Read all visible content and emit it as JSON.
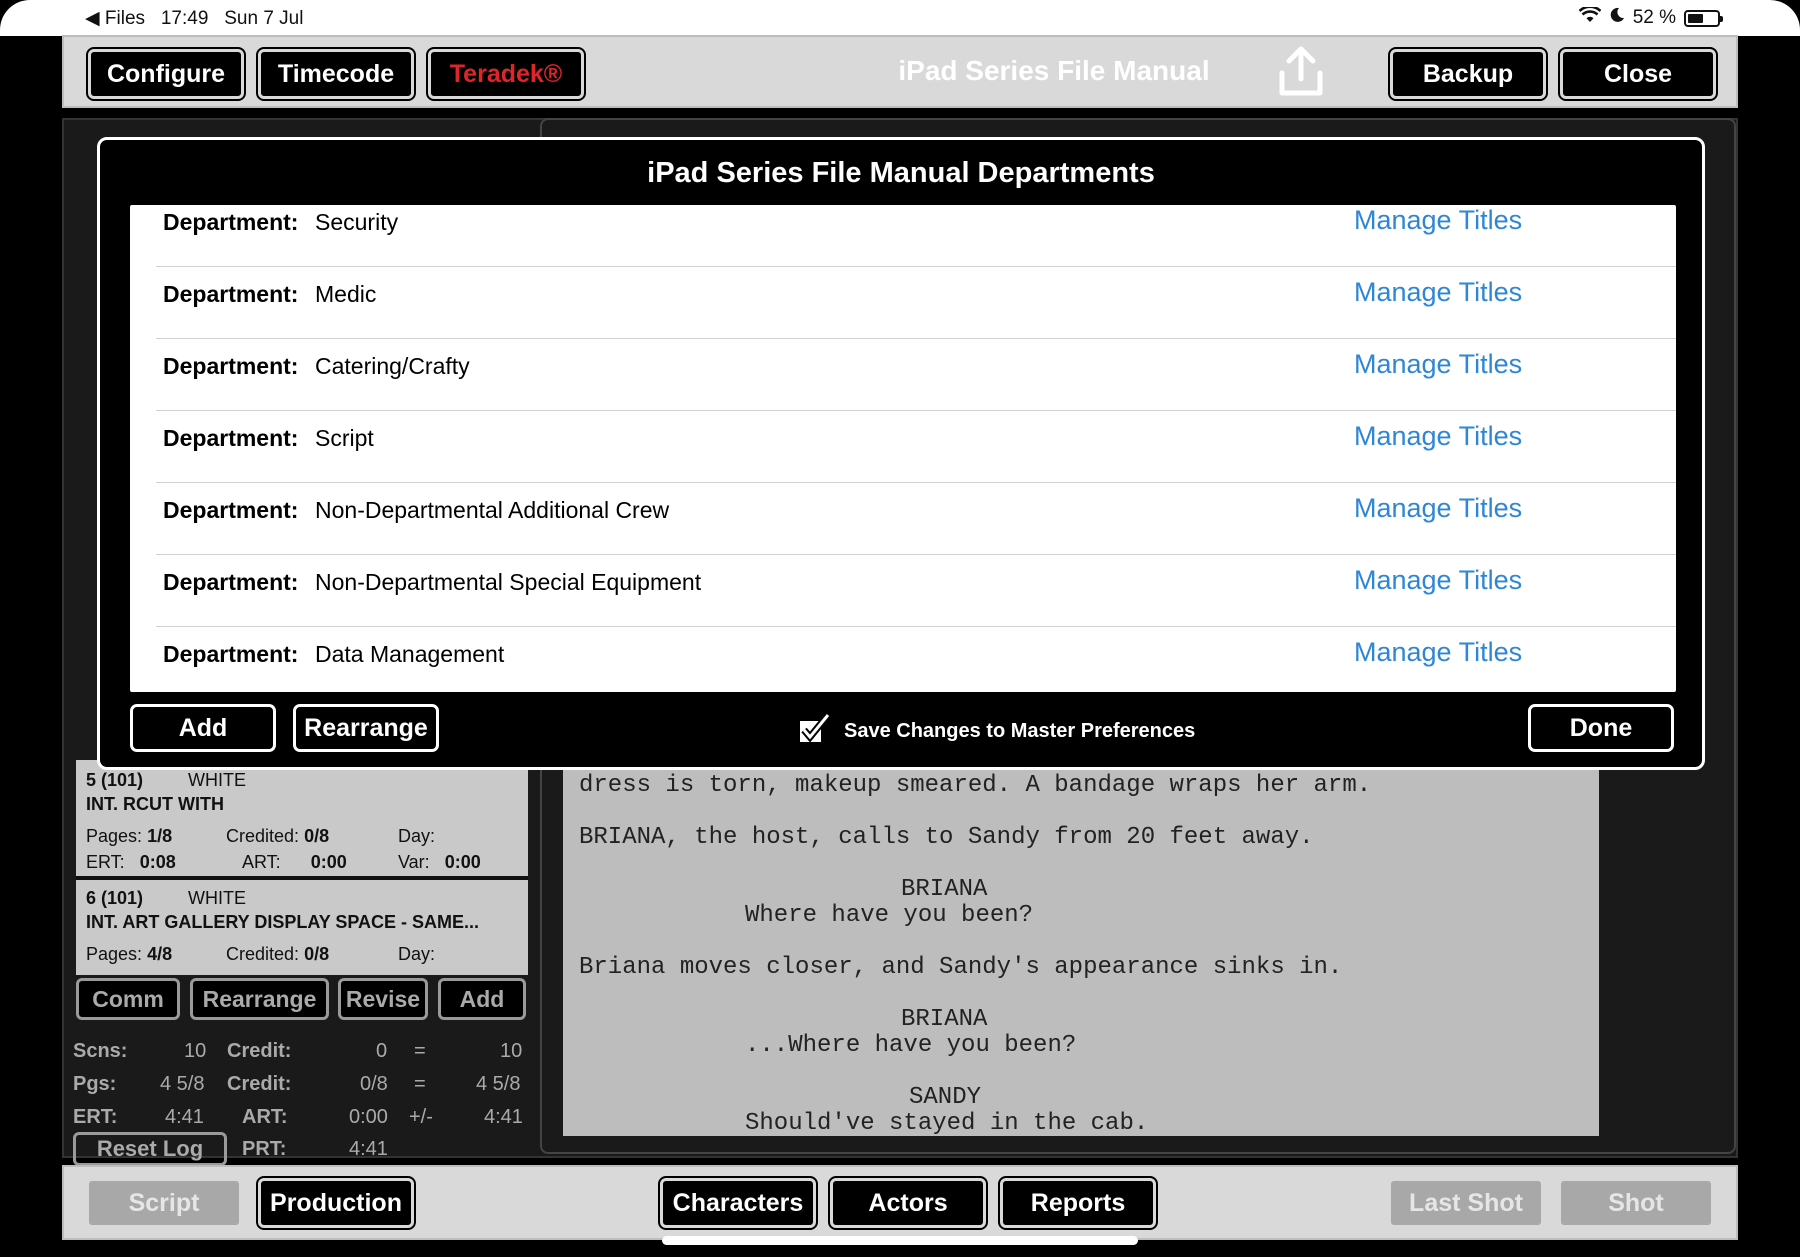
{
  "status": {
    "back_app": "Files",
    "time": "17:49",
    "date": "Sun 7 Jul",
    "battery": "52 %"
  },
  "toolbar": {
    "configure": "Configure",
    "timecode": "Timecode",
    "teradek": "Teradek®",
    "title": "iPad Series File Manual",
    "backup": "Backup",
    "close": "Close"
  },
  "modal": {
    "title": "iPad Series File Manual Departments",
    "dept_label": "Department:",
    "manage_label": "Manage Titles",
    "departments": [
      "Security",
      "Medic",
      "Catering/Crafty",
      "Script",
      "Non-Departmental Additional Crew",
      "Non-Departmental Special Equipment",
      "Data Management"
    ],
    "add": "Add",
    "rearrange": "Rearrange",
    "save_pref": "Save Changes to Master Preferences",
    "done": "Done"
  },
  "scenes": [
    {
      "num": "5 (101)",
      "color": "WHITE",
      "slug": "INT. RCUT WITH",
      "pages": "1/8",
      "credited": "0/8",
      "ert": "0:08",
      "art": "0:00",
      "var": "0:00"
    },
    {
      "num": "6 (101)",
      "color": "WHITE",
      "slug": "INT. ART GALLERY DISPLAY SPACE - SAME...",
      "pages": "4/8",
      "credited": "0/8"
    }
  ],
  "scene_labels": {
    "pages": "Pages:",
    "credited": "Credited:",
    "day": "Day:",
    "ert": "ERT:",
    "art": "ART:",
    "var": "Var:"
  },
  "list_buttons": {
    "comm": "Comm",
    "rearrange": "Rearrange",
    "revise": "Revise",
    "add": "Add"
  },
  "stats": {
    "scns_l": "Scns:",
    "scns": "10",
    "credit_l": "Credit:",
    "credit": "0",
    "eq": "=",
    "scns_total": "10",
    "pgs_l": "Pgs:",
    "pgs": "4 5/8",
    "credit2_l": "Credit:",
    "credit2": "0/8",
    "eq2": "=",
    "pgs_total": "4 5/8",
    "ert_l": "ERT:",
    "ert": "4:41",
    "art_l": "ART:",
    "art": "0:00",
    "pm": "+/-",
    "ert_total": "4:41",
    "reset": "Reset Log",
    "prt_l": "PRT:",
    "prt": "4:41"
  },
  "script_lines": [
    "dress is torn, makeup smeared. A bandage wraps her arm.",
    "BRIANA, the host, calls to Sandy from 20 feet away.",
    "BRIANA",
    "Where have you been?",
    "Briana moves closer, and Sandy's appearance sinks in.",
    "BRIANA",
    "...Where have you been?",
    "SANDY",
    "Should've stayed in the cab."
  ],
  "bottombar": {
    "script": "Script",
    "production": "Production",
    "characters": "Characters",
    "actors": "Actors",
    "reports": "Reports",
    "last_shot": "Last Shot",
    "shot": "Shot"
  }
}
